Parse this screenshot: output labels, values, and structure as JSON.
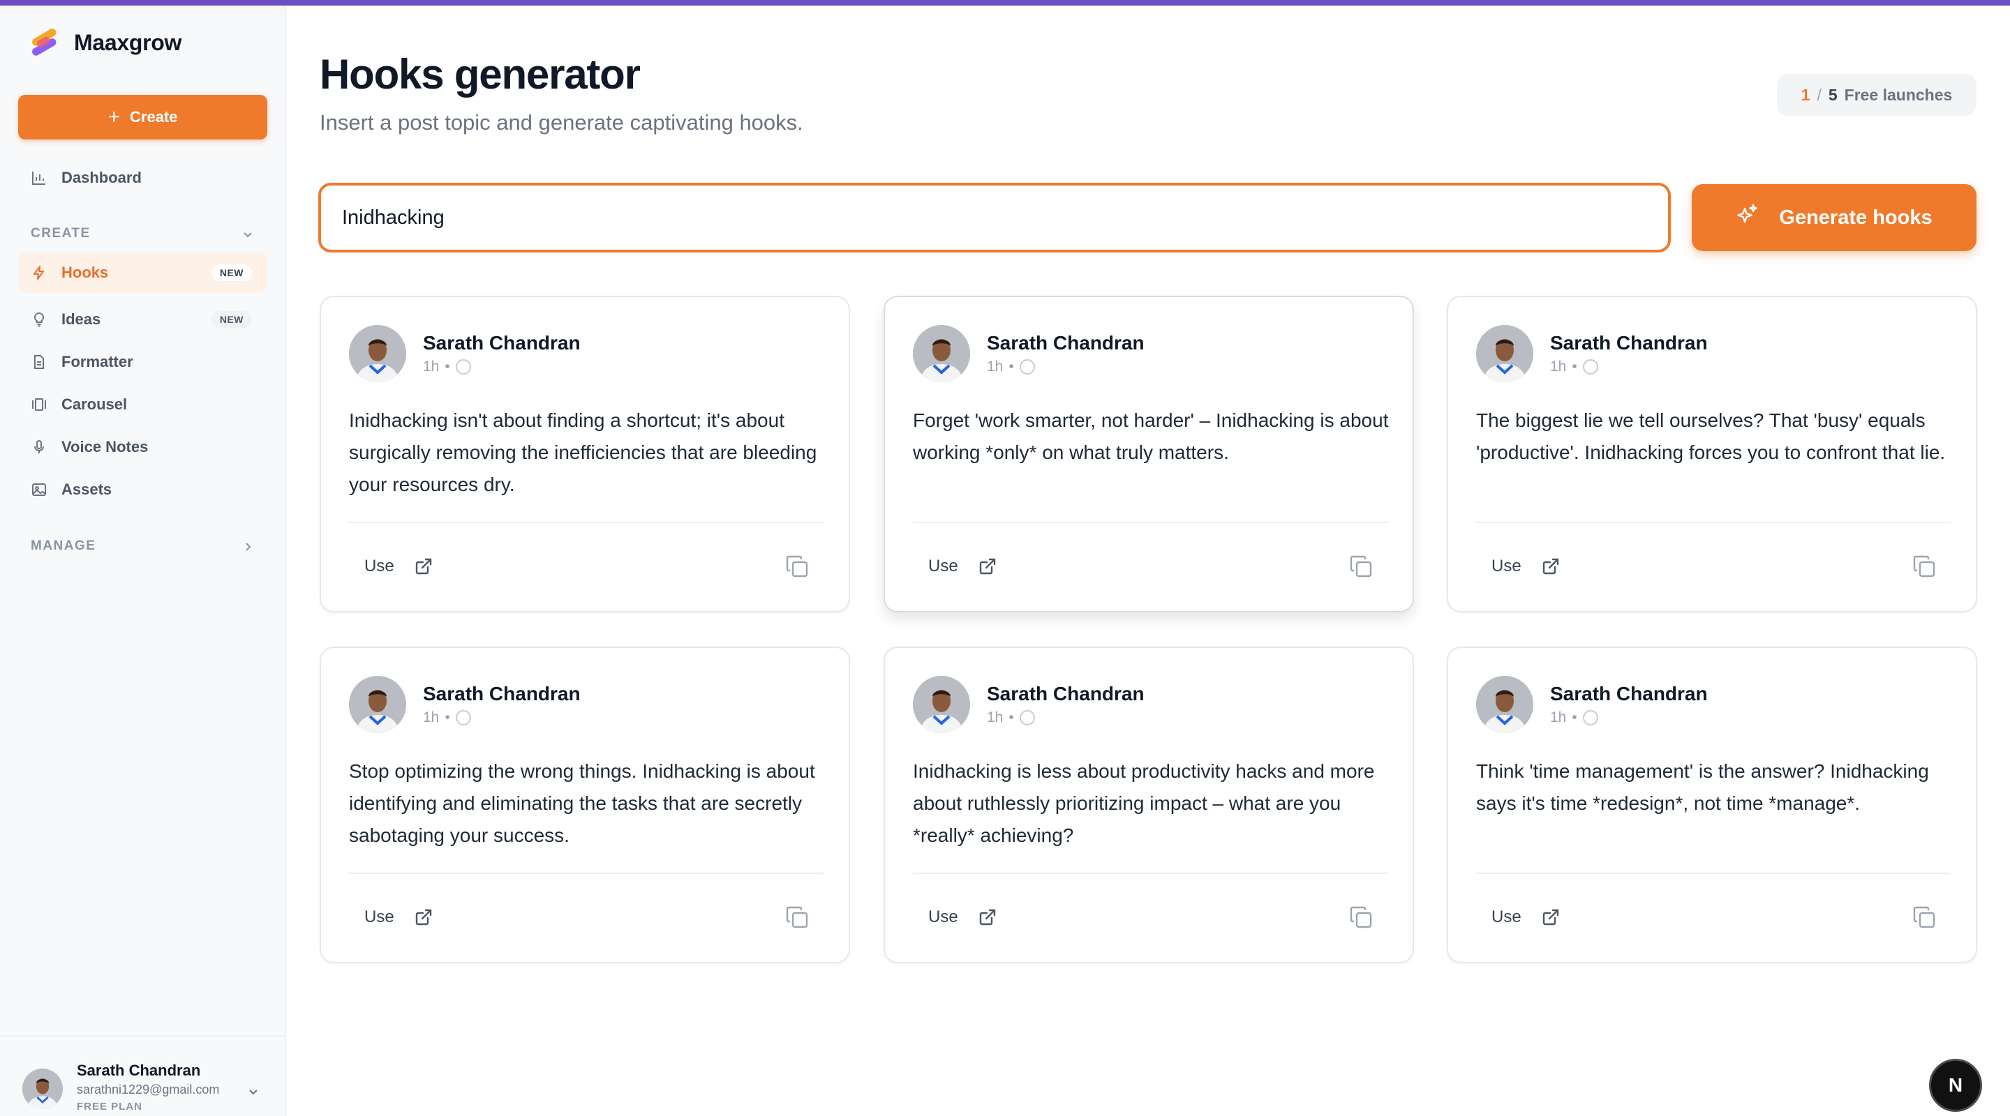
{
  "app": {
    "name": "Maaxgrow",
    "accent": "#f07a2b",
    "topbar_color": "#6d4fc2"
  },
  "sidebar": {
    "create_label": "Create",
    "dashboard": {
      "label": "Dashboard",
      "icon": "bar-chart-icon"
    },
    "create_section": "CREATE",
    "items": [
      {
        "label": "Hooks",
        "icon": "bolt-icon",
        "badge": "NEW",
        "active": true
      },
      {
        "label": "Ideas",
        "icon": "lightbulb-icon",
        "badge": "NEW"
      },
      {
        "label": "Formatter",
        "icon": "document-icon"
      },
      {
        "label": "Carousel",
        "icon": "carousel-icon"
      },
      {
        "label": "Voice Notes",
        "icon": "microphone-icon"
      },
      {
        "label": "Assets",
        "icon": "image-icon"
      }
    ],
    "manage_section": "MANAGE",
    "profile": {
      "name": "Sarath Chandran",
      "email": "sarathni1229@gmail.com",
      "plan": "FREE PLAN"
    }
  },
  "main": {
    "title": "Hooks generator",
    "subtitle": "Insert a post topic and generate captivating hooks.",
    "launches": {
      "used": "1",
      "separator": "/",
      "total": "5",
      "label": "Free launches"
    },
    "topic_input_value": "Inidhacking",
    "generate_label": "Generate hooks"
  },
  "cards": [
    {
      "author": "Sarath Chandran",
      "time": "1h",
      "text": "Inidhacking isn't about finding a shortcut; it's about surgically removing the inefficiencies that are bleeding your resources dry.",
      "use_label": "Use"
    },
    {
      "author": "Sarath Chandran",
      "time": "1h",
      "text": "Forget 'work smarter, not harder' – Inidhacking is about working *only* on what truly matters.",
      "use_label": "Use"
    },
    {
      "author": "Sarath Chandran",
      "time": "1h",
      "text": "The biggest lie we tell ourselves? That 'busy' equals 'productive'. Inidhacking forces you to confront that lie.",
      "use_label": "Use"
    },
    {
      "author": "Sarath Chandran",
      "time": "1h",
      "text": "Stop optimizing the wrong things. Inidhacking is about identifying and eliminating the tasks that are secretly sabotaging your success.",
      "use_label": "Use"
    },
    {
      "author": "Sarath Chandran",
      "time": "1h",
      "text": "Inidhacking is less about productivity hacks and more about ruthlessly prioritizing impact – what are you *really* achieving?",
      "use_label": "Use"
    },
    {
      "author": "Sarath Chandran",
      "time": "1h",
      "text": "Think 'time management' is the answer? Inidhacking says it's time *redesign*, not time *manage*.",
      "use_label": "Use"
    }
  ],
  "floating_badge": {
    "letter": "N"
  }
}
